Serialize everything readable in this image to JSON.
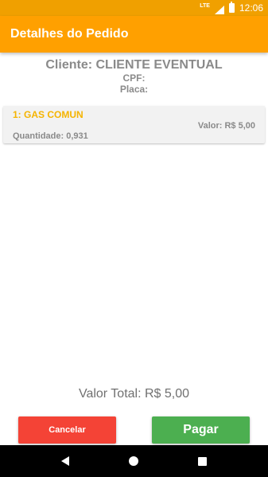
{
  "status_bar": {
    "network_label": "LTE",
    "time": "12:06"
  },
  "app_bar": {
    "title": "Detalhes do Pedido"
  },
  "customer": {
    "name_line": "Cliente: CLIENTE EVENTUAL",
    "cpf_line": "CPF:",
    "plate_line": "Placa:"
  },
  "items": [
    {
      "title": "1: GAS COMUN",
      "value": "Valor: R$ 5,00",
      "quantity": "Quantidade: 0,931"
    }
  ],
  "total": "Valor Total: R$ 5,00",
  "actions": {
    "cancel_label": "Cancelar",
    "pay_label": "Pagar"
  },
  "colors": {
    "accent": "#ffa000",
    "item_title": "#f5b400",
    "cancel": "#f44336",
    "pay": "#4caf50"
  }
}
